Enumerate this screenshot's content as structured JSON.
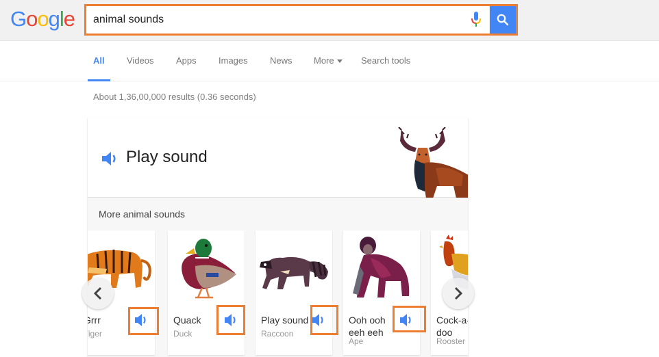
{
  "header": {
    "logo_letters": [
      {
        "char": "G",
        "color": "#4285f4"
      },
      {
        "char": "o",
        "color": "#ea4335"
      },
      {
        "char": "o",
        "color": "#fbbc05"
      },
      {
        "char": "g",
        "color": "#4285f4"
      },
      {
        "char": "l",
        "color": "#34a853"
      },
      {
        "char": "e",
        "color": "#ea4335"
      }
    ],
    "search_value": "animal sounds",
    "mic_icon": "microphone-icon",
    "search_icon": "search-icon",
    "highlight_color": "#ed7d31",
    "accent_color": "#4285f4"
  },
  "nav": {
    "tabs": [
      {
        "label": "All",
        "active": true
      },
      {
        "label": "Videos"
      },
      {
        "label": "Apps"
      },
      {
        "label": "Images"
      },
      {
        "label": "News"
      },
      {
        "label": "More"
      },
      {
        "label": "Search tools"
      }
    ]
  },
  "results": {
    "stats": "About 1,36,00,000 results (0.36 seconds)"
  },
  "card": {
    "play_label": "Play sound",
    "speaker_icon": "speaker-icon",
    "featured_animal": "Moose",
    "more_label": "More animal sounds",
    "tiles": [
      {
        "sound": "Grrr",
        "animal": "Tiger"
      },
      {
        "sound": "Quack",
        "animal": "Duck"
      },
      {
        "sound": "Play sound",
        "animal": "Raccoon"
      },
      {
        "sound": "Ooh ooh eeh eeh",
        "animal": "Ape"
      },
      {
        "sound": "Cock-a-doodle-doo",
        "animal": "Rooster"
      }
    ],
    "prev_icon": "chevron-left-icon",
    "next_icon": "chevron-right-icon"
  }
}
